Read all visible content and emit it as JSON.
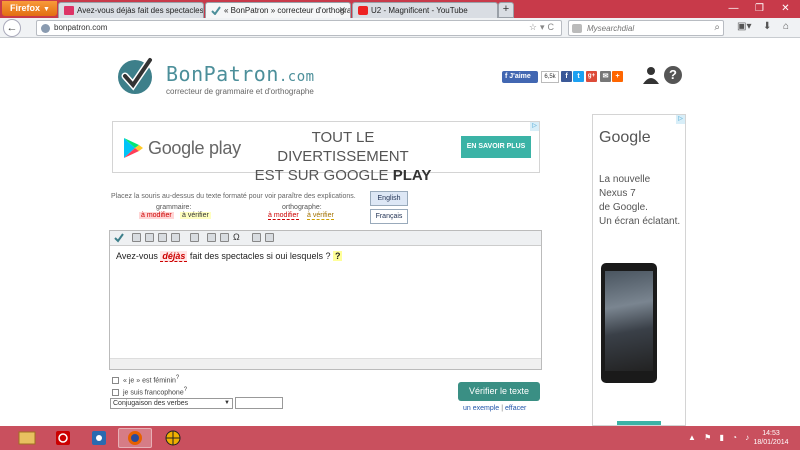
{
  "browser": {
    "menu_label": "Firefox",
    "tabs": [
      {
        "title": "Avez-vous déjàs fait des spectacles et..."
      },
      {
        "title": "« BonPatron » correcteur d'orthograp..."
      },
      {
        "title": "U2 - Magnificent - YouTube"
      }
    ],
    "new_tab": "+",
    "url": "bonpatron.com",
    "search_placeholder": "Mysearchdial"
  },
  "site": {
    "logo_name": "BonPatron",
    "logo_tld": ".com",
    "tagline": "correcteur de grammaire et d'orthographe",
    "fb_like": "J'aime",
    "fb_count": "6,5k",
    "help": "?"
  },
  "ad_top": {
    "brand": "Google play",
    "headline_line1": "TOUT LE DIVERTISSEMENT",
    "headline_line2_prefix": "EST SUR GOOGLE ",
    "headline_line2_bold": "PLAY",
    "cta": "EN SAVOIR PLUS"
  },
  "ad_side": {
    "brand": "Google",
    "line1": "La nouvelle",
    "line2": "Nexus 7",
    "line3": "de Google.",
    "line4": "Un écran éclatant."
  },
  "legend": {
    "instructions": "Placez la souris au-dessus du texte formaté pour voir paraître des explications.",
    "grammar_label": "grammaire:",
    "spelling_label": "orthographe:",
    "modify": "à modifier",
    "verify": "à vérifier"
  },
  "languages": {
    "english": "English",
    "french": "Français"
  },
  "editor": {
    "before": "Avez-vous ",
    "error_word": "déjàs",
    "middle": " fait des spectacles si oui lesquels ? ",
    "question": "?"
  },
  "options": {
    "feminine": "« je » est féminin",
    "francophone": "je suis francophone",
    "sup": "?",
    "conjugation": "Conjugaison des verbes"
  },
  "actions": {
    "verify": "Vérifier le texte",
    "example": "un exemple",
    "separator": "|",
    "clear": "effacer"
  },
  "taskbar": {
    "time": "14:53",
    "date": "18/01/2014"
  }
}
